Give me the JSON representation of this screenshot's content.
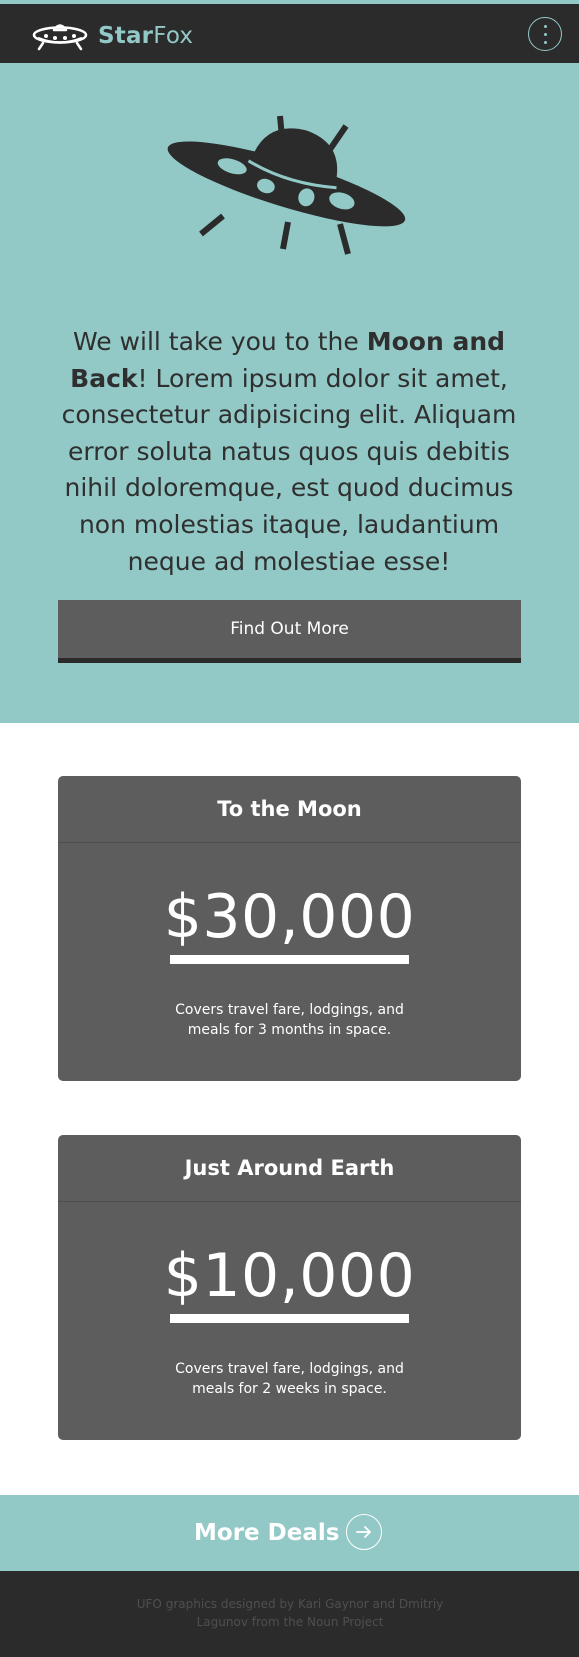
{
  "header": {
    "brand_part1": "Star",
    "brand_part2": "Fox",
    "menu_icon": "vertical-dots-icon",
    "brand_color": "#92c9c6",
    "background_color": "#2b2b2b"
  },
  "hero": {
    "illustration": "ufo-icon",
    "intro": "We will take you to the ",
    "highlight": "Moon and Back",
    "body": "! Lorem ipsum dolor sit amet, consectetur adipisicing elit. Aliquam error soluta natus quos quis debitis nihil doloremque, est quod ducimus non molestias itaque, laudantium neque ad molestiae esse!",
    "cta_label": "Find Out More",
    "background_color": "#92c9c6"
  },
  "deals": [
    {
      "title": "To the Moon",
      "price": "$30,000",
      "description": "Covers travel fare, lodgings, and meals for 3 months in space."
    },
    {
      "title": "Just Around Earth",
      "price": "$10,000",
      "description": "Covers travel fare, lodgings, and meals for 2 weeks in space."
    }
  ],
  "more": {
    "label": "More Deals",
    "icon": "arrow-right-icon"
  },
  "footer": {
    "credit": "UFO graphics designed by Kari Gaynor and Dmitriy Lagunov from the Noun Project"
  }
}
